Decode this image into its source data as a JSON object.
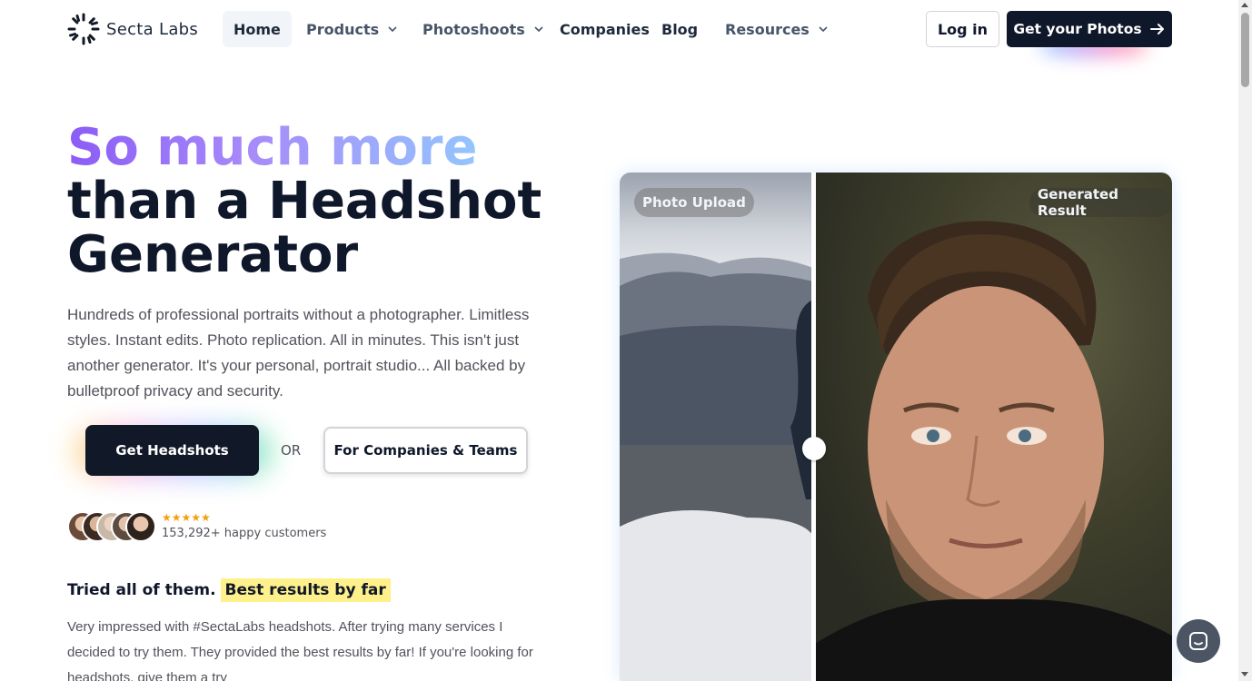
{
  "nav": {
    "brand": "Secta Labs",
    "items": [
      {
        "label": "Home"
      },
      {
        "label": "Products"
      },
      {
        "label": "Photoshoots"
      },
      {
        "label": "Companies"
      },
      {
        "label": "Blog"
      },
      {
        "label": "Resources"
      }
    ],
    "login": "Log in",
    "cta": "Get your Photos"
  },
  "hero": {
    "title_gradient": "So much more",
    "title_line2": "than a Headshot",
    "title_line3": "Generator",
    "description": "Hundreds of professional portraits without a photographer. Limitless styles. Instant edits. Photo replication. All in minutes. This isn't just another generator. It's your personal, portrait studio... All backed by bulletproof privacy and security.",
    "primary_button": "Get Headshots",
    "or": "OR",
    "secondary_button": "For Companies & Teams",
    "rating_stars": "★★★★★",
    "customers": "153,292+ happy customers"
  },
  "review": {
    "lead": "Tried all of them.",
    "highlight": "Best results by far",
    "text": "Very impressed with #SectaLabs headshots. After trying many services I decided to try them. They provided the best results by far! If you're looking for headshots, give them a try"
  },
  "compare": {
    "left_label": "Photo Upload",
    "right_label": "Generated Result"
  },
  "colors": {
    "brand_dark": "#0f172a",
    "gradient_start": "#8b5cf6",
    "gradient_end": "#93c5fd",
    "highlight": "#fef08a"
  }
}
